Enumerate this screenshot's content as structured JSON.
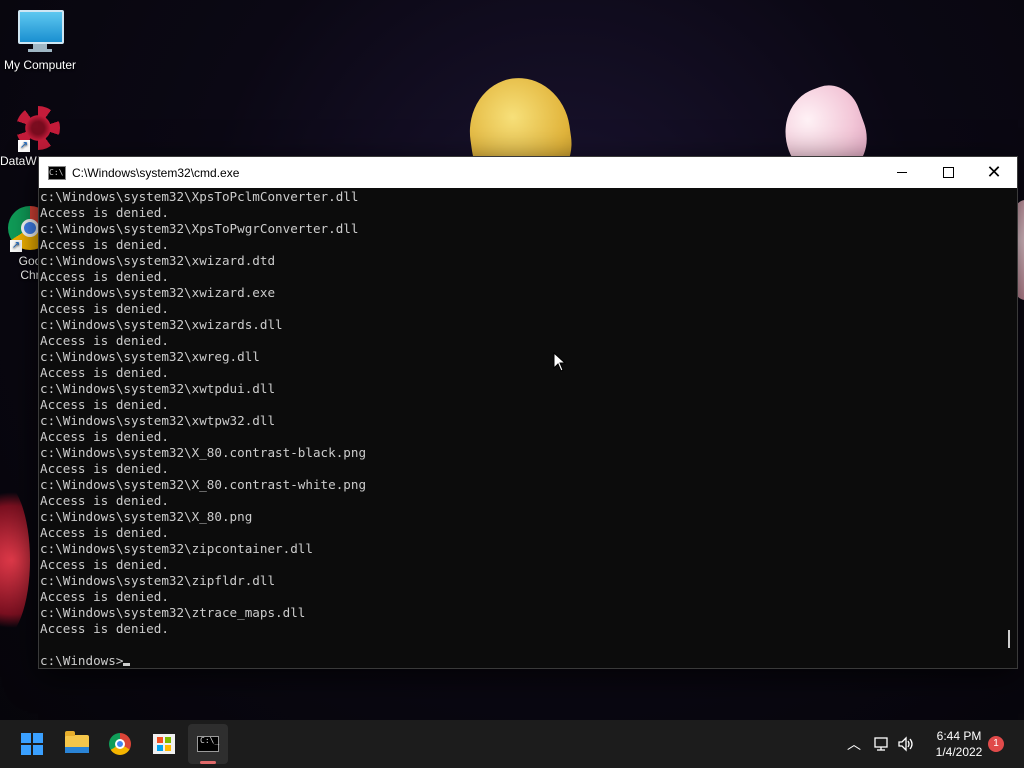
{
  "desktop": {
    "icons": [
      {
        "label": "My Computer",
        "icon": "monitor-icon"
      },
      {
        "label": "DataW",
        "icon": "datawrapper-icon"
      },
      {
        "label": "Goo\nChr",
        "icon": "chrome-icon"
      }
    ]
  },
  "window": {
    "title": "C:\\Windows\\system32\\cmd.exe",
    "buttons": {
      "minimize": "minimize",
      "maximize": "maximize",
      "close": "close"
    }
  },
  "console": {
    "lines": [
      "c:\\Windows\\system32\\XpsToPclmConverter.dll",
      "Access is denied.",
      "c:\\Windows\\system32\\XpsToPwgrConverter.dll",
      "Access is denied.",
      "c:\\Windows\\system32\\xwizard.dtd",
      "Access is denied.",
      "c:\\Windows\\system32\\xwizard.exe",
      "Access is denied.",
      "c:\\Windows\\system32\\xwizards.dll",
      "Access is denied.",
      "c:\\Windows\\system32\\xwreg.dll",
      "Access is denied.",
      "c:\\Windows\\system32\\xwtpdui.dll",
      "Access is denied.",
      "c:\\Windows\\system32\\xwtpw32.dll",
      "Access is denied.",
      "c:\\Windows\\system32\\X_80.contrast-black.png",
      "Access is denied.",
      "c:\\Windows\\system32\\X_80.contrast-white.png",
      "Access is denied.",
      "c:\\Windows\\system32\\X_80.png",
      "Access is denied.",
      "c:\\Windows\\system32\\zipcontainer.dll",
      "Access is denied.",
      "c:\\Windows\\system32\\zipfldr.dll",
      "Access is denied.",
      "c:\\Windows\\system32\\ztrace_maps.dll",
      "Access is denied.",
      "",
      "c:\\Windows>"
    ]
  },
  "taskbar": {
    "apps": [
      "start-icon",
      "file-explorer-icon",
      "chrome-icon",
      "store-icon",
      "terminal-icon"
    ],
    "tray": {
      "time": "6:44 PM",
      "date": "1/4/2022",
      "notifications": "1"
    }
  }
}
